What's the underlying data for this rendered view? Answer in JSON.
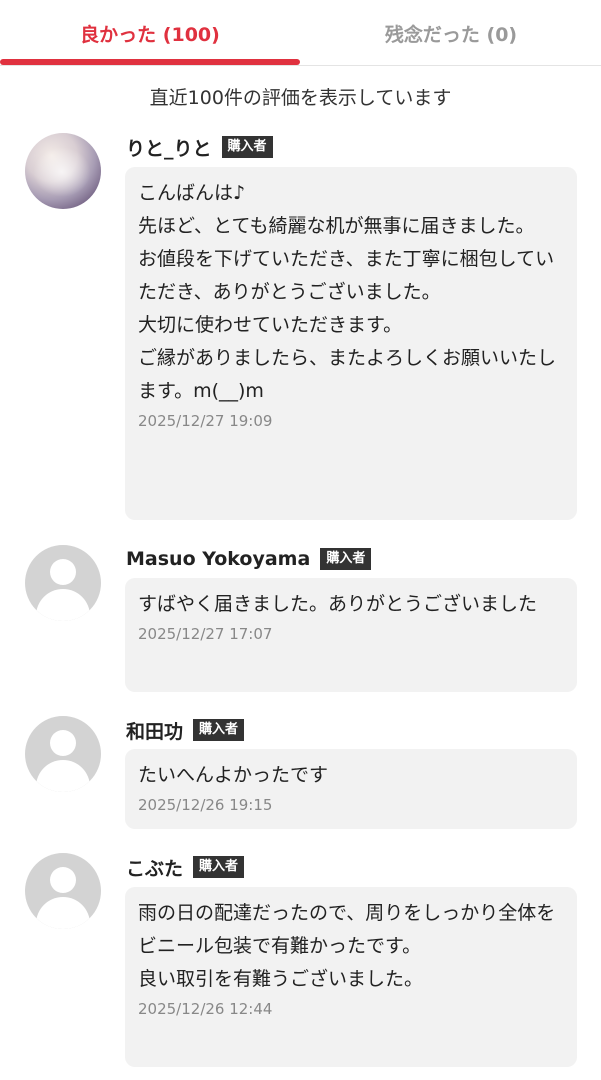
{
  "tabs": {
    "good_label": "良かった (100)",
    "bad_label": "残念だった (0)"
  },
  "notice": "直近100件の評価を表示しています",
  "reviews": [
    {
      "name": "りと_りと",
      "badge": "購入者",
      "comment": "こんばんは♪\n先ほど、とても綺麗な机が無事に届きました。\nお値段を下げていただき、また丁寧に梱包していただき、ありがとうございました。\n大切に使わせていただきます。\nご縁がありましたら、またよろしくお願いいたします。m(__)m",
      "date": "2025/12/27 19:09",
      "avatar_icon": "user-photo-icon"
    },
    {
      "name": "Masuo Yokoyama",
      "badge": "購入者",
      "comment": "すばやく届きました。ありがとうございました",
      "date": "2025/12/27 17:07",
      "avatar_icon": "default-user-icon"
    },
    {
      "name": "和田功",
      "badge": "購入者",
      "comment": "たいへんよかったです",
      "date": "2025/12/26 19:15",
      "avatar_icon": "default-user-icon"
    },
    {
      "name": "こぶた",
      "badge": "購入者",
      "comment": "雨の日の配達だったので、周りをしっかり全体をビニール包装で有難かったです。\n良い取引を有難うございました。",
      "date": "2025/12/26 12:44",
      "avatar_icon": "default-user-icon"
    }
  ],
  "colors": {
    "accent": "#e0313f",
    "inactive_tab": "#9a9a9a",
    "bubble_bg": "#f2f2f2",
    "badge_bg": "#333333"
  }
}
